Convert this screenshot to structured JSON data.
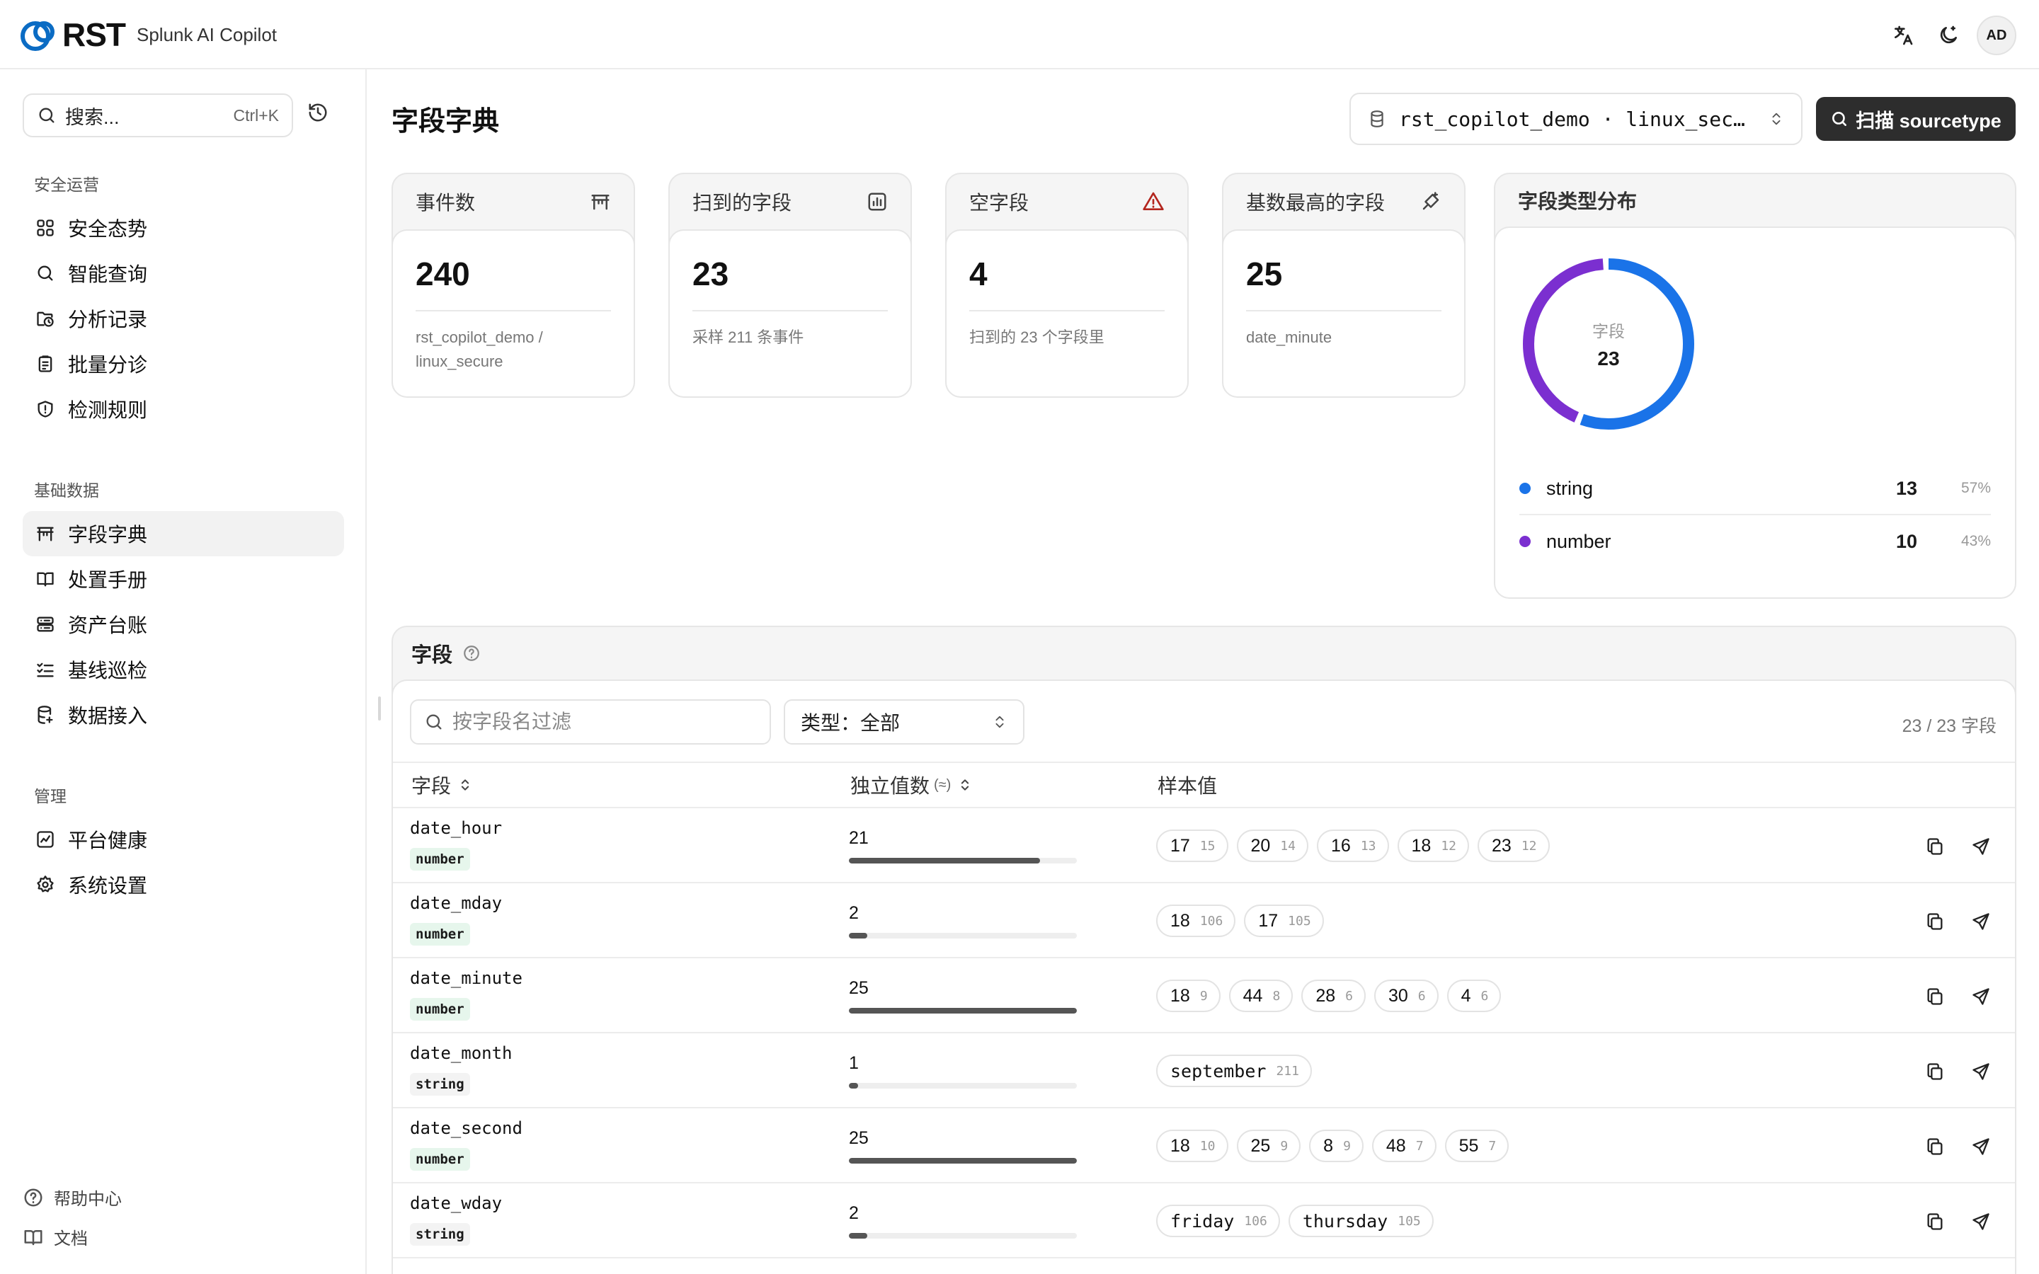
{
  "app": {
    "logo_text": "RST",
    "subtitle": "Splunk AI Copilot",
    "user_initials": "AD"
  },
  "sidebar": {
    "search_placeholder": "搜索...",
    "search_shortcut": "Ctrl+K",
    "sections": [
      {
        "title": "安全运营",
        "items": [
          {
            "label": "安全态势",
            "icon": "grid-icon"
          },
          {
            "label": "智能查询",
            "icon": "search-icon"
          },
          {
            "label": "分析记录",
            "icon": "history-folder-icon"
          },
          {
            "label": "批量分诊",
            "icon": "clipboard-icon"
          },
          {
            "label": "检测规则",
            "icon": "shield-icon"
          }
        ]
      },
      {
        "title": "基础数据",
        "items": [
          {
            "label": "字段字典",
            "icon": "table-icon",
            "active": true
          },
          {
            "label": "处置手册",
            "icon": "book-icon"
          },
          {
            "label": "资产台账",
            "icon": "server-icon"
          },
          {
            "label": "基线巡检",
            "icon": "checklist-icon"
          },
          {
            "label": "数据接入",
            "icon": "database-icon"
          }
        ]
      },
      {
        "title": "管理",
        "items": [
          {
            "label": "平台健康",
            "icon": "activity-icon"
          },
          {
            "label": "系统设置",
            "icon": "gear-icon"
          }
        ]
      }
    ],
    "footer": [
      {
        "label": "帮助中心",
        "icon": "help-icon"
      },
      {
        "label": "文档",
        "icon": "docs-icon"
      }
    ]
  },
  "page": {
    "title": "字段字典",
    "source_select": "rst_copilot_demo · linux_sec…",
    "scan_button": "扫描 sourcetype"
  },
  "stats": [
    {
      "title": "事件数",
      "value": "240",
      "sub": "rst_copilot_demo / linux_secure",
      "icon": "table-icon"
    },
    {
      "title": "扫到的字段",
      "value": "23",
      "sub": "采样 211 条事件",
      "icon": "chart-icon"
    },
    {
      "title": "空字段",
      "value": "4",
      "sub": "扫到的 23 个字段里",
      "icon": "warning-icon"
    },
    {
      "title": "基数最高的字段",
      "value": "25",
      "sub": "date_minute",
      "icon": "sparkle-icon"
    }
  ],
  "distribution": {
    "title": "字段类型分布",
    "center_label": "字段",
    "center_value": "23",
    "items": [
      {
        "name": "string",
        "count": "13",
        "pct": "57%",
        "color": "#1a73e8"
      },
      {
        "name": "number",
        "count": "10",
        "pct": "43%",
        "color": "#7b2fd0"
      }
    ]
  },
  "fields": {
    "title": "字段",
    "filter_placeholder": "按字段名过滤",
    "type_filter": "类型：全部",
    "count_text": "23 / 23 字段",
    "columns": {
      "name": "字段",
      "cardinality": "独立值数",
      "cardinality_sub": "(≈)",
      "samples": "样本值"
    },
    "rows": [
      {
        "name": "date_hour",
        "type": "number",
        "cardinality": "21",
        "fill": 0.84,
        "samples": [
          {
            "v": "17",
            "c": "15"
          },
          {
            "v": "20",
            "c": "14"
          },
          {
            "v": "16",
            "c": "13"
          },
          {
            "v": "18",
            "c": "12"
          },
          {
            "v": "23",
            "c": "12"
          }
        ]
      },
      {
        "name": "date_mday",
        "type": "number",
        "cardinality": "2",
        "fill": 0.08,
        "samples": [
          {
            "v": "18",
            "c": "106"
          },
          {
            "v": "17",
            "c": "105"
          }
        ]
      },
      {
        "name": "date_minute",
        "type": "number",
        "cardinality": "25",
        "fill": 1.0,
        "samples": [
          {
            "v": "18",
            "c": "9"
          },
          {
            "v": "44",
            "c": "8"
          },
          {
            "v": "28",
            "c": "6"
          },
          {
            "v": "30",
            "c": "6"
          },
          {
            "v": "4",
            "c": "6"
          }
        ]
      },
      {
        "name": "date_month",
        "type": "string",
        "cardinality": "1",
        "fill": 0.04,
        "samples": [
          {
            "v": "september",
            "c": "211"
          }
        ]
      },
      {
        "name": "date_second",
        "type": "number",
        "cardinality": "25",
        "fill": 1.0,
        "samples": [
          {
            "v": "18",
            "c": "10"
          },
          {
            "v": "25",
            "c": "9"
          },
          {
            "v": "8",
            "c": "9"
          },
          {
            "v": "48",
            "c": "7"
          },
          {
            "v": "55",
            "c": "7"
          }
        ]
      },
      {
        "name": "date_wday",
        "type": "string",
        "cardinality": "2",
        "fill": 0.08,
        "samples": [
          {
            "v": "friday",
            "c": "106"
          },
          {
            "v": "thursday",
            "c": "105"
          }
        ]
      }
    ]
  }
}
